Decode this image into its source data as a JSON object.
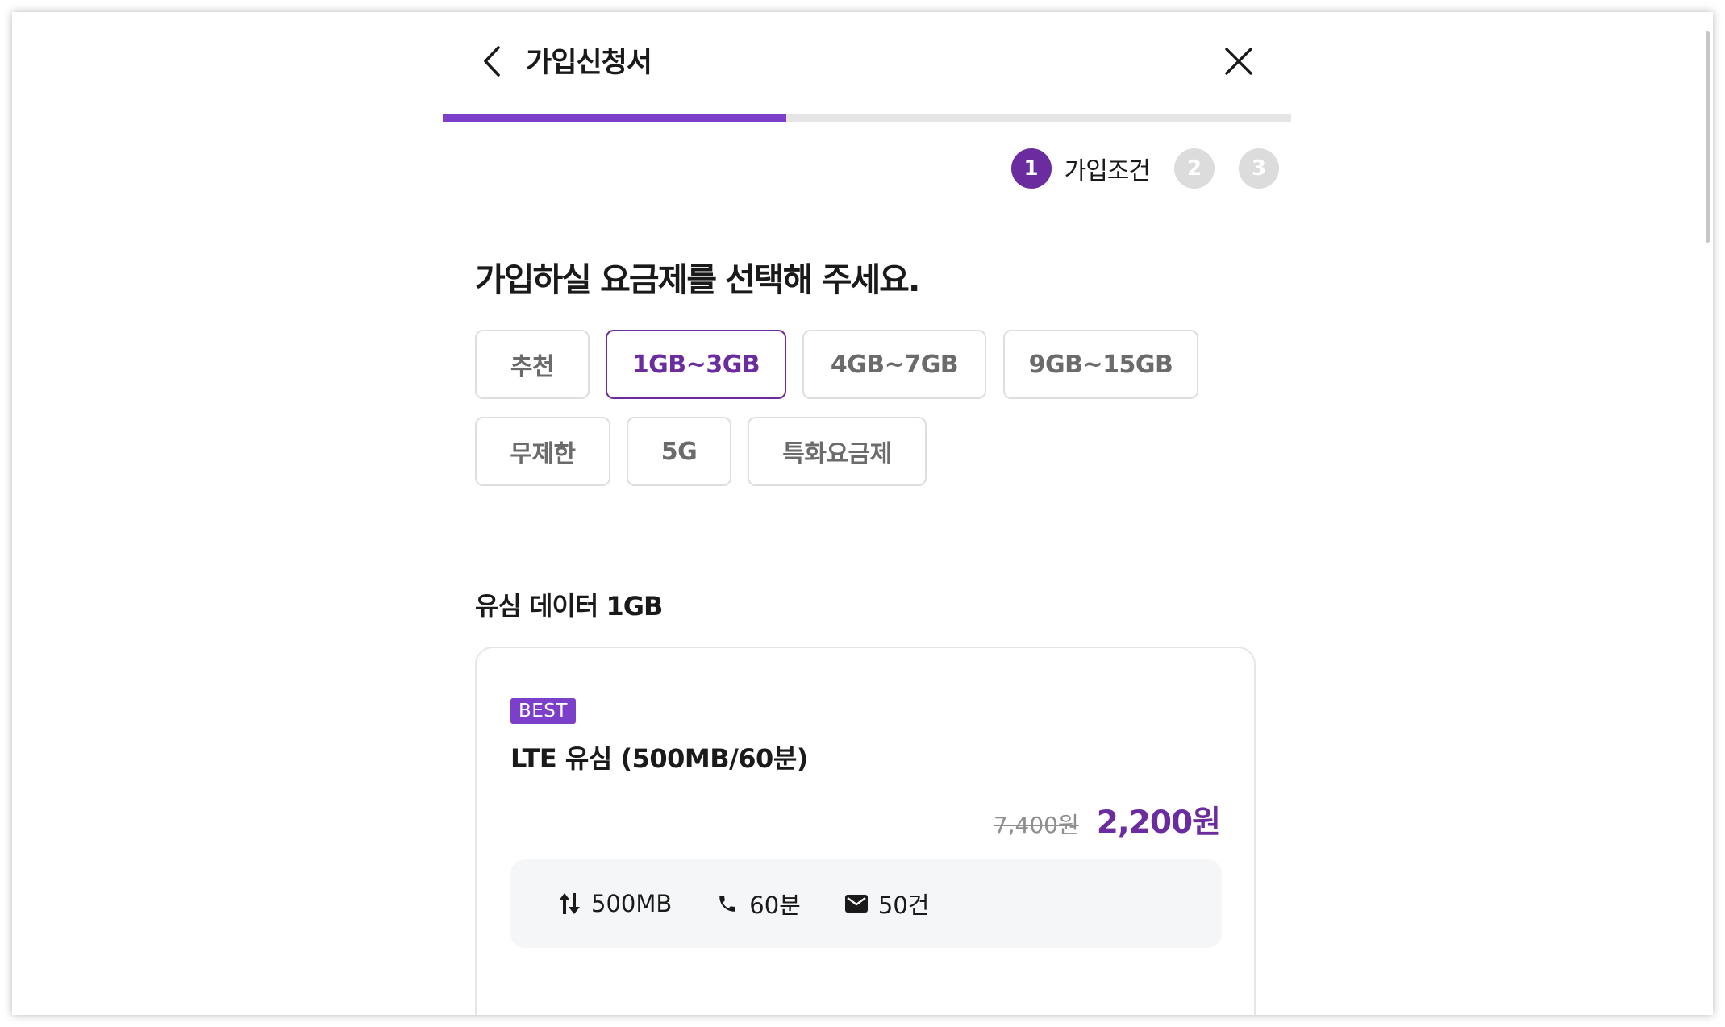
{
  "header": {
    "title": "가입신청서",
    "back_icon": "chevron-left-icon",
    "close_icon": "close-icon"
  },
  "progress": {
    "fraction": 0.405,
    "color": "#7b3fc9"
  },
  "steps": [
    {
      "number": "1",
      "label": "가입조건",
      "active": true
    },
    {
      "number": "2",
      "active": false
    },
    {
      "number": "3",
      "active": false
    }
  ],
  "main": {
    "heading": "가입하실 요금제를 선택해 주세요.",
    "filters": [
      {
        "label": "추천",
        "selected": false
      },
      {
        "label": "1GB~3GB",
        "selected": true
      },
      {
        "label": "4GB~7GB",
        "selected": false
      },
      {
        "label": "9GB~15GB",
        "selected": false
      },
      {
        "label": "무제한",
        "selected": false
      },
      {
        "label": "5G",
        "selected": false
      },
      {
        "label": "특화요금제",
        "selected": false
      }
    ],
    "section_title": "유심 데이터 1GB"
  },
  "plan": {
    "badge": "BEST",
    "name": "LTE 유심 (500MB/60분)",
    "original_price": "7,400원",
    "sale_price": "2,200원",
    "features": [
      {
        "icon": "data-transfer-icon",
        "text": "500MB"
      },
      {
        "icon": "phone-icon",
        "text": "60분"
      },
      {
        "icon": "mail-icon",
        "text": "50건"
      }
    ]
  },
  "colors": {
    "accent": "#6a2c9e",
    "badge": "#7b3fc9"
  }
}
